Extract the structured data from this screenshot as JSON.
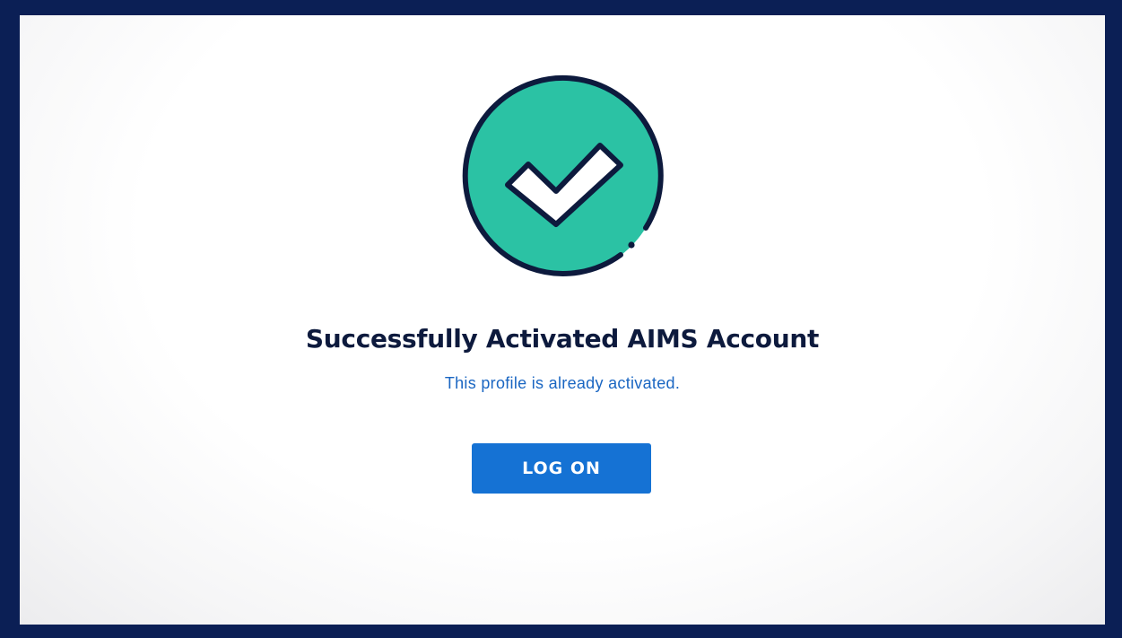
{
  "status": {
    "title": "Successfully Activated AIMS Account",
    "message": "This profile is already activated."
  },
  "actions": {
    "logon_label": "LOG ON"
  },
  "icon": {
    "name": "checkmark-circle-icon",
    "fill_color": "#2bc2a4",
    "outline_color": "#0d1a3d"
  },
  "theme": {
    "frame_color": "#0b1f55",
    "accent_color": "#1572d4"
  }
}
